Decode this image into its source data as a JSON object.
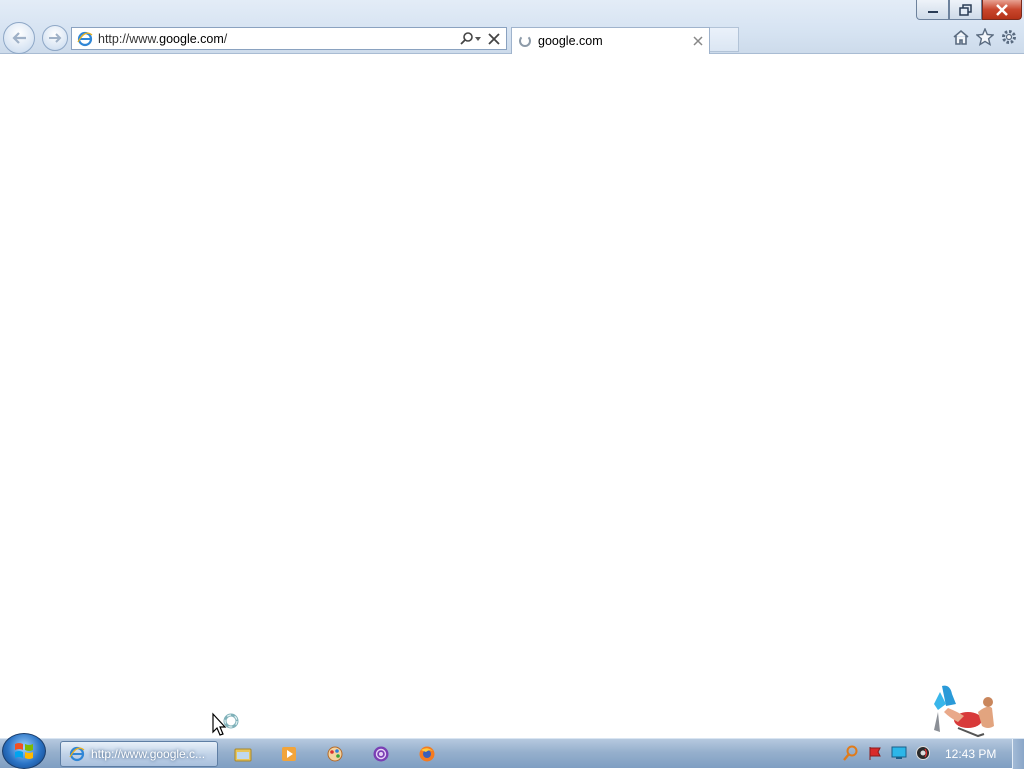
{
  "browser": {
    "address_bar": {
      "url_prefix": "http://www.",
      "url_domain": "google.com",
      "url_suffix": "/"
    },
    "tab": {
      "title": "google.com"
    },
    "toolbar_icons": [
      "home-icon",
      "favorites-star-icon",
      "tools-gear-icon"
    ]
  },
  "taskbar": {
    "active_window_label": "http://www.google.c...",
    "pinned_icons": [
      "explorer-folder-icon",
      "media-player-icon",
      "paint-icon",
      "tor-browser-icon",
      "firefox-icon"
    ],
    "tray_icons": [
      "search-tray-icon",
      "flag-action-center-icon",
      "network-monitor-icon",
      "volume-icon"
    ],
    "clock": "12:43 PM"
  },
  "colors": {
    "chrome_bg": "#d6e3f2",
    "taskbar_bg": "#96b0cd",
    "close_button": "#c9462d"
  }
}
